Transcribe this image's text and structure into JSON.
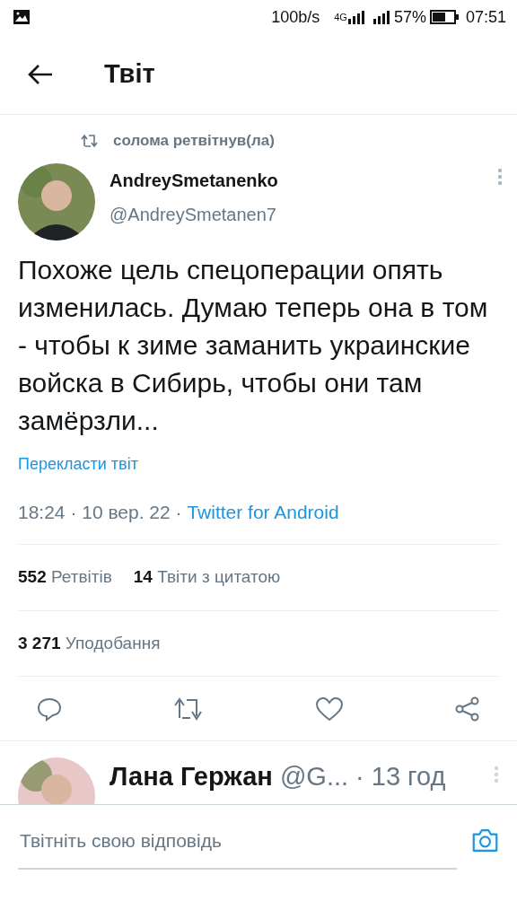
{
  "status_bar": {
    "speed": "100b/s",
    "network": "4G",
    "battery": "57%",
    "time": "07:51"
  },
  "header": {
    "title": "Твіт"
  },
  "tweet": {
    "retweeted_by": "солома ретвітнув(ла)",
    "name": "AndreySmetanenko",
    "handle": "@AndreySmetanen7",
    "text": "Похоже цель спецоперации опять изменилась. Думаю теперь она в том - чтобы к зиме заманить украинские войска в Сибирь, чтобы они там замёрзли...",
    "translate": "Перекласти твіт",
    "time": "18:24 · 10 вер. 22 · ",
    "source": "Twitter for Android",
    "stats": [
      {
        "count": "552",
        "label": "Ретвітів"
      },
      {
        "count": "14",
        "label": "Твіти з цитатою"
      }
    ],
    "likes": {
      "count": "3 271",
      "label": "Уподобання"
    }
  },
  "reply": {
    "name": "Лана Гержан",
    "handle": "@G...",
    "time": "· 13 год"
  },
  "compose": {
    "placeholder": "Твітніть свою відповідь"
  }
}
